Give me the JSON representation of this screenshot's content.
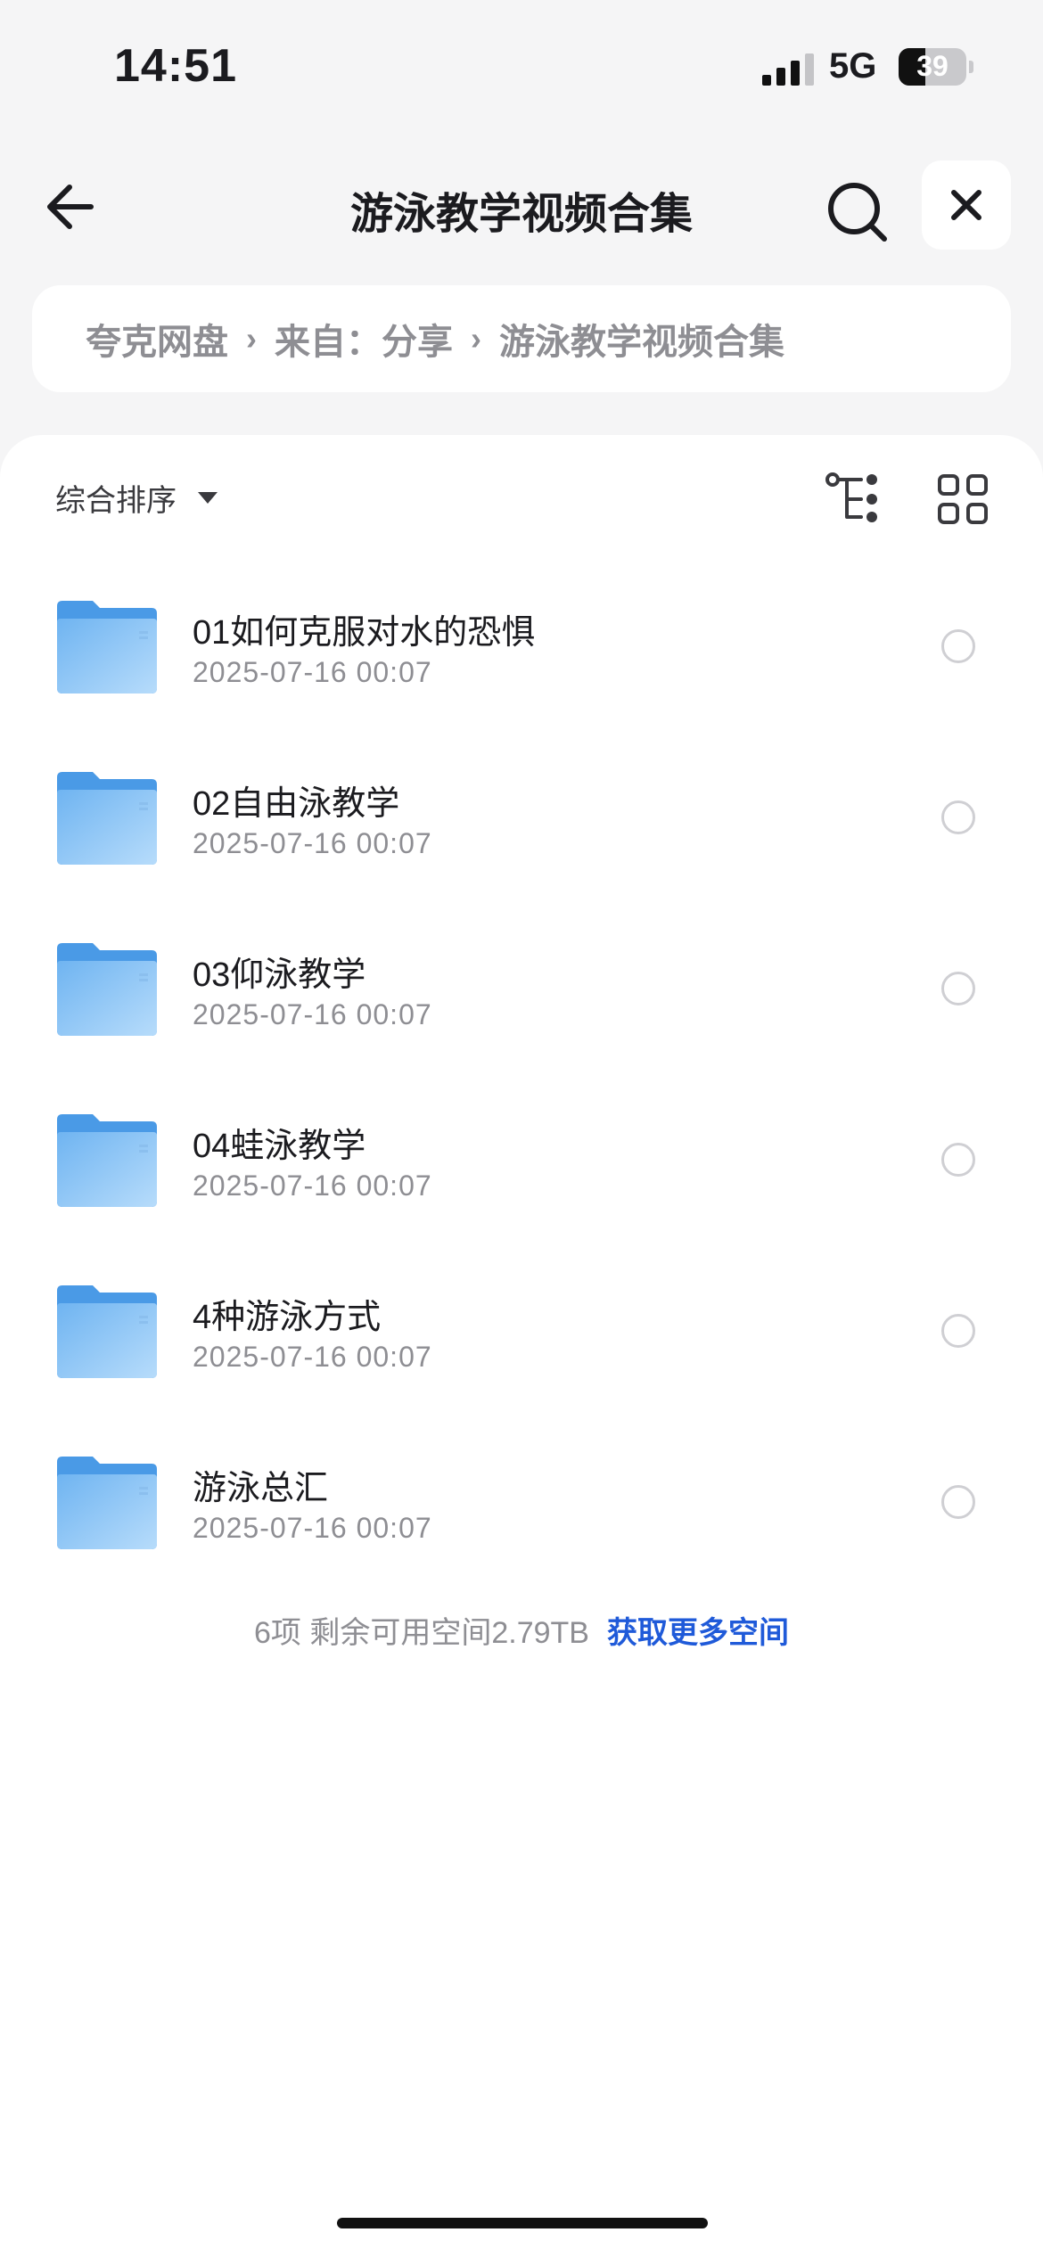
{
  "status_bar": {
    "time": "14:51",
    "network": "5G",
    "battery": "39",
    "battery_level": 0.39
  },
  "header": {
    "title": "游泳教学视频合集"
  },
  "breadcrumb": [
    {
      "label": "夸克网盘"
    },
    {
      "label": "来自：分享"
    },
    {
      "label": "游泳教学视频合集"
    }
  ],
  "toolbar": {
    "sort_label": "综合排序"
  },
  "folders": [
    {
      "name": "01如何克服对水的恐惧",
      "date": "2025-07-16 00:07"
    },
    {
      "name": "02自由泳教学",
      "date": "2025-07-16 00:07"
    },
    {
      "name": "03仰泳教学",
      "date": "2025-07-16 00:07"
    },
    {
      "name": "04蛙泳教学",
      "date": "2025-07-16 00:07"
    },
    {
      "name": "4种游泳方式",
      "date": "2025-07-16 00:07"
    },
    {
      "name": "游泳总汇",
      "date": "2025-07-16 00:07"
    }
  ],
  "footer": {
    "summary": "6项 剩余可用空间2.79TB",
    "link": "获取更多空间"
  },
  "colors": {
    "accent": "#1f5ad9",
    "folder": "#5aa8ef",
    "background": "#f5f5f6"
  },
  "icons": {
    "back": "arrow-left-icon",
    "search": "search-icon",
    "close": "close-icon",
    "tree": "tree-view-icon",
    "grid": "grid-view-icon",
    "folder": "folder-icon"
  }
}
